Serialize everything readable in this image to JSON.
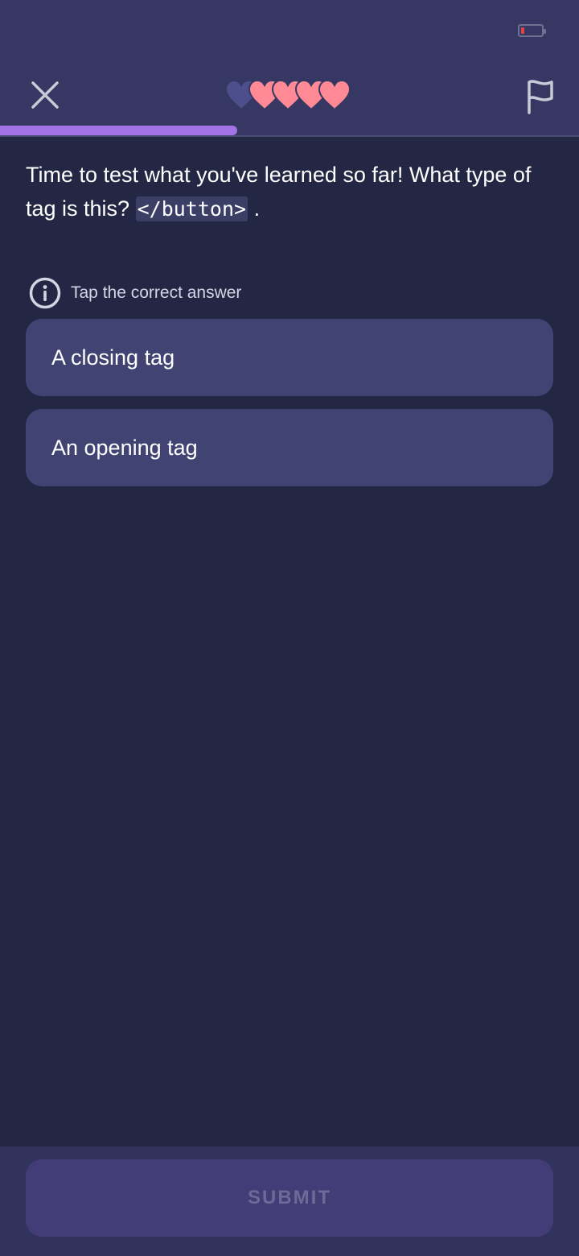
{
  "status_bar": {
    "battery_icon": "battery-low-icon",
    "battery_level": "low"
  },
  "header": {
    "close_icon": "close-icon",
    "flag_icon": "flag-icon",
    "hearts": {
      "total": 5,
      "filled": 4,
      "filled_color": "#ff8a95",
      "empty_color": "#4c4f8c"
    },
    "progress_fraction": 0.41,
    "progress_color": "#a274e6"
  },
  "question": {
    "text_before": "Time to test what you've learned so far! What type of tag is this?",
    "code": "</button>",
    "text_after": "."
  },
  "hint": {
    "icon": "info-icon",
    "label": "Tap the correct answer"
  },
  "answers": [
    {
      "label": "A closing tag"
    },
    {
      "label": "An opening tag"
    }
  ],
  "submit": {
    "label": "SUBMIT",
    "state": "disabled"
  }
}
